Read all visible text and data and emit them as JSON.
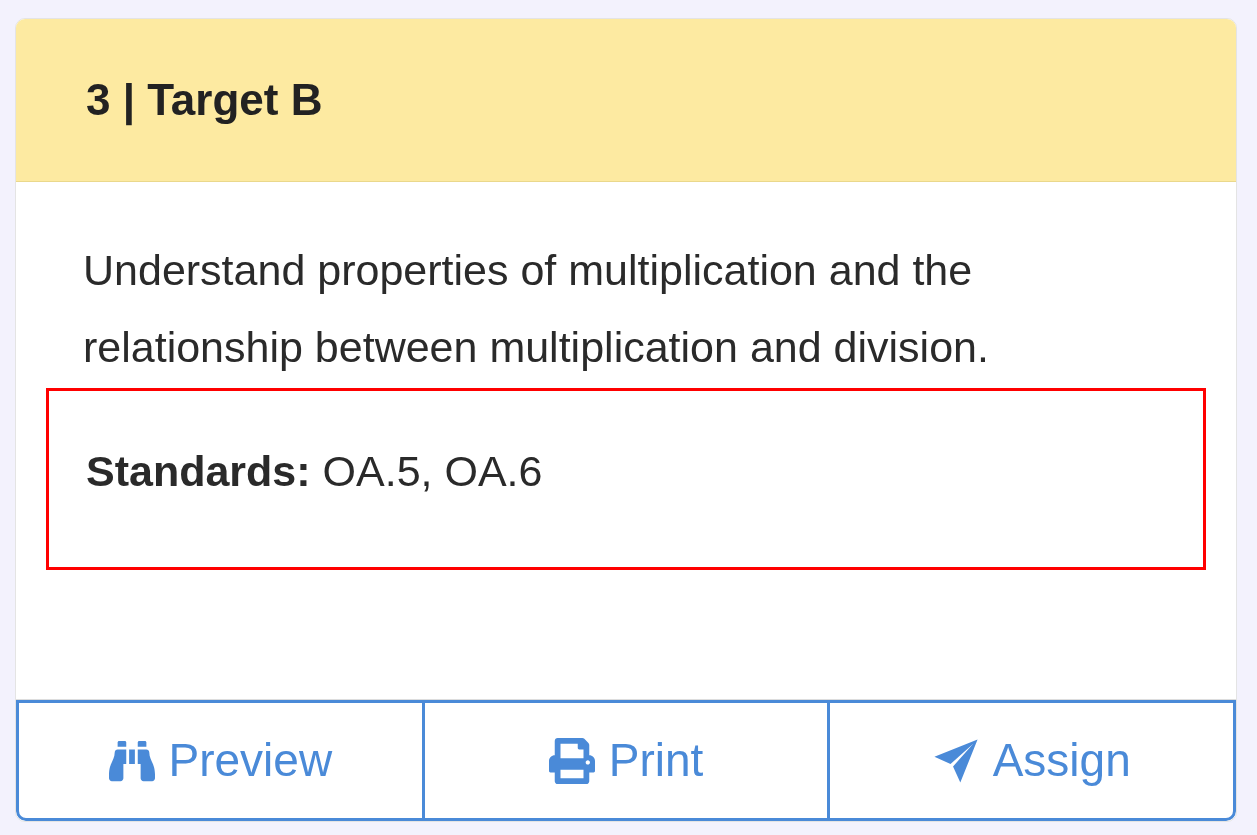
{
  "card": {
    "title": "3 | Target B",
    "description": "Understand properties of multiplication and the relationship between multiplication and division.",
    "standards": {
      "label": "Standards:",
      "value": "OA.5, OA.6",
      "highlighted": true
    },
    "buttons": [
      {
        "label": "Preview"
      },
      {
        "label": "Print"
      },
      {
        "label": "Assign"
      }
    ]
  }
}
